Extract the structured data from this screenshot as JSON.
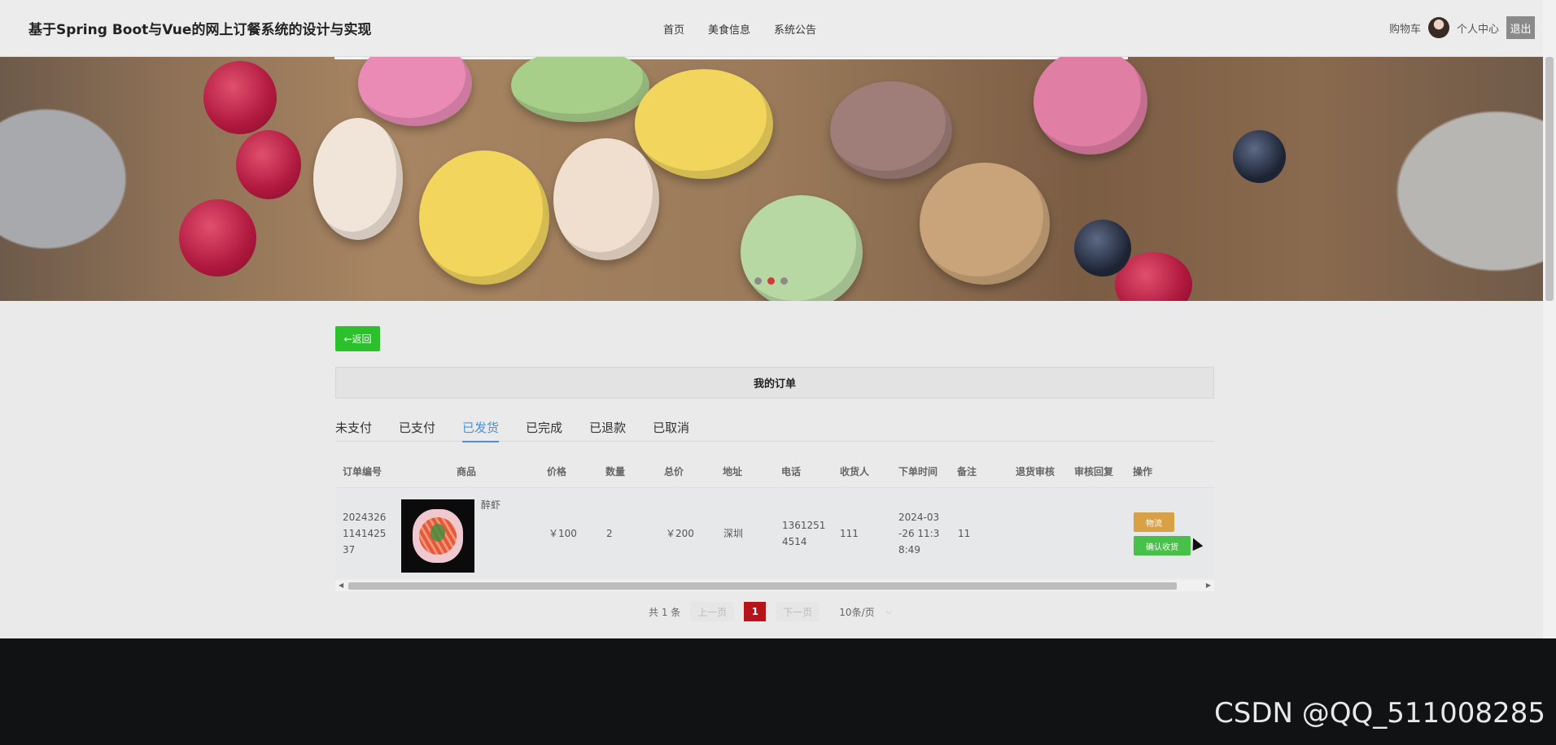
{
  "header": {
    "site_title": "基于Spring Boot与Vue的网上订餐系统的设计与实现",
    "nav": [
      "首页",
      "美食信息",
      "系统公告"
    ],
    "cart": "购物车",
    "profile": "个人中心",
    "logout": "退出"
  },
  "main": {
    "back_label": "←返回",
    "title": "我的订单",
    "tabs": [
      "未支付",
      "已支付",
      "已发货",
      "已完成",
      "已退款",
      "已取消"
    ],
    "active_tab": "已发货",
    "columns": [
      "订单编号",
      "商品",
      "价格",
      "数量",
      "总价",
      "地址",
      "电话",
      "收货人",
      "下单时间",
      "备注",
      "退货审核",
      "审核回复",
      "操作"
    ],
    "rows": [
      {
        "order_no": "2024326114142537",
        "order_no_lines": [
          "2024326",
          "1141425",
          "37"
        ],
        "product": "醉虾",
        "price": "￥100",
        "quantity": "2",
        "total": "￥200",
        "address": "深圳",
        "phone": "13612514514",
        "phone_lines": [
          "1361251",
          "4514"
        ],
        "receiver": "111",
        "order_time": "2024-03-26 11:38:49",
        "order_time_lines": [
          "2024-03",
          "-26 11:3",
          "8:49"
        ],
        "remark": "11",
        "return_review": "",
        "review_reply": "",
        "actions": [
          "物流",
          "确认收货"
        ]
      }
    ]
  },
  "pagination": {
    "total": "共 1 条",
    "prev": "上一页",
    "current": "1",
    "next": "下一页",
    "page_size": "10条/页"
  },
  "watermark": "CSDN @QQ_511008285"
}
